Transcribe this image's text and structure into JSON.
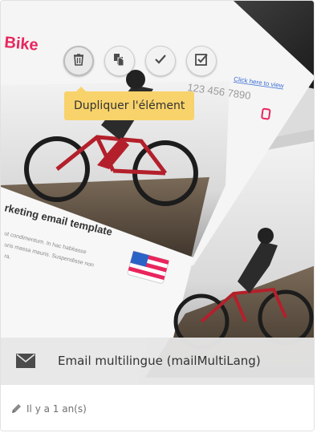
{
  "thumbnail": {
    "heading": "Bike",
    "phone": "123 456 7890",
    "link_text": "Click here to view",
    "subheading": "rketing email template",
    "body_line1": "ut condimentum. In hac habitasse",
    "body_line2": "uris massa mauris. Suspendisse non",
    "body_line3": "ra."
  },
  "actions": {
    "delete_icon": "trash-icon",
    "duplicate_icon": "duplicate-icon",
    "check_icon": "checkmark-icon",
    "select_icon": "checkbox-icon"
  },
  "tooltip": {
    "text": "Dupliquer l'élément"
  },
  "card": {
    "title": "Email multilingue (mailMultiLang)",
    "modified": "Il y a 1 an(s)"
  },
  "colors": {
    "tooltip_bg": "#f8d26b",
    "brand_pink": "#e8265e"
  }
}
